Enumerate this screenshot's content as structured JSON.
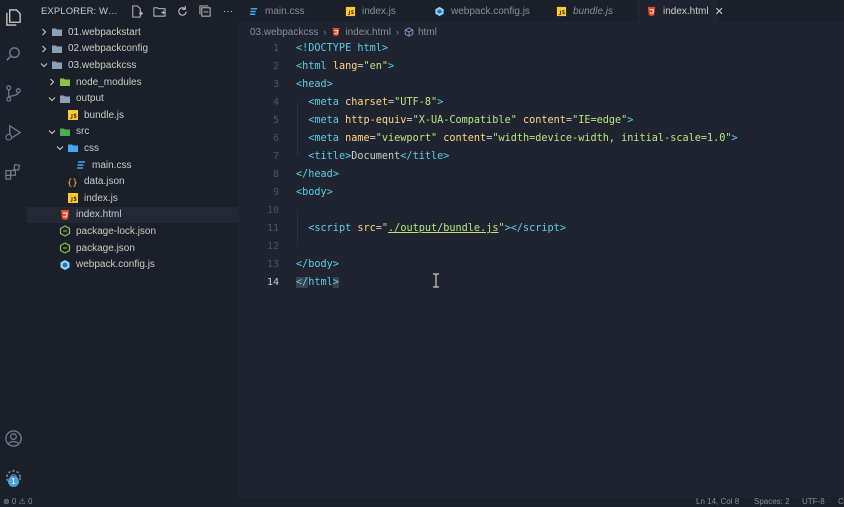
{
  "explorer": {
    "title": "EXPLORER: WPC...",
    "actions": [
      "new-file-icon",
      "new-folder-icon",
      "refresh-icon",
      "collapse-icon",
      "more-icon"
    ],
    "more_label": "···"
  },
  "tree": [
    {
      "label": "01.webpackstart",
      "type": "folder",
      "expanded": false,
      "indent": 0
    },
    {
      "label": "02.webpackconfig",
      "type": "folder",
      "expanded": false,
      "indent": 0
    },
    {
      "label": "03.webpackcss",
      "type": "folder",
      "expanded": true,
      "indent": 0
    },
    {
      "label": "node_modules",
      "type": "folder-node",
      "expanded": false,
      "indent": 1
    },
    {
      "label": "output",
      "type": "folder",
      "expanded": true,
      "indent": 1
    },
    {
      "label": "bundle.js",
      "type": "js",
      "indent": 2
    },
    {
      "label": "src",
      "type": "folder-src",
      "expanded": true,
      "indent": 1
    },
    {
      "label": "css",
      "type": "folder-css",
      "expanded": true,
      "indent": 2
    },
    {
      "label": "main.css",
      "type": "css",
      "indent": 3
    },
    {
      "label": "data.json",
      "type": "json",
      "indent": 2
    },
    {
      "label": "index.js",
      "type": "js",
      "indent": 2
    },
    {
      "label": "index.html",
      "type": "html",
      "indent": 1,
      "selected": true
    },
    {
      "label": "package-lock.json",
      "type": "npm",
      "indent": 1
    },
    {
      "label": "package.json",
      "type": "npm",
      "indent": 1
    },
    {
      "label": "webpack.config.js",
      "type": "webpack",
      "indent": 1
    }
  ],
  "tabs": [
    {
      "label": "main.css",
      "type": "css",
      "italic": false,
      "active": false
    },
    {
      "label": "index.js",
      "type": "js",
      "italic": false,
      "active": false
    },
    {
      "label": "webpack.config.js",
      "type": "webpack",
      "italic": false,
      "active": false
    },
    {
      "label": "bundle.js",
      "type": "js",
      "italic": true,
      "active": false
    },
    {
      "label": "index.html",
      "type": "html",
      "italic": false,
      "active": true,
      "close": "✕"
    }
  ],
  "breadcrumb": {
    "folder": "03.webpackcss",
    "file": "index.html",
    "symbol": "html",
    "separator": "›"
  },
  "editor": {
    "current_line": 14,
    "lines": [
      {
        "n": "1",
        "tokens": [
          {
            "t": "<!DOCTYPE html>",
            "c": "tag"
          }
        ]
      },
      {
        "n": "2",
        "tokens": [
          {
            "t": "<",
            "c": "punc"
          },
          {
            "t": "html",
            "c": "tag"
          },
          {
            "t": " lang",
            "c": "attr"
          },
          {
            "t": "=",
            "c": "txt"
          },
          {
            "t": "\"en\"",
            "c": "str"
          },
          {
            "t": ">",
            "c": "punc"
          }
        ]
      },
      {
        "n": "3",
        "tokens": [
          {
            "t": "<",
            "c": "punc"
          },
          {
            "t": "head",
            "c": "tag"
          },
          {
            "t": ">",
            "c": "punc"
          }
        ]
      },
      {
        "n": "4",
        "tokens": [
          {
            "t": "  <",
            "c": "punc"
          },
          {
            "t": "meta",
            "c": "tag"
          },
          {
            "t": " charset",
            "c": "attr"
          },
          {
            "t": "=",
            "c": "txt"
          },
          {
            "t": "\"UTF-8\"",
            "c": "str"
          },
          {
            "t": ">",
            "c": "punc"
          }
        ]
      },
      {
        "n": "5",
        "tokens": [
          {
            "t": "  <",
            "c": "punc"
          },
          {
            "t": "meta",
            "c": "tag"
          },
          {
            "t": " http-equiv",
            "c": "attr"
          },
          {
            "t": "=",
            "c": "txt"
          },
          {
            "t": "\"X-UA-Compatible\"",
            "c": "str"
          },
          {
            "t": " content",
            "c": "attr"
          },
          {
            "t": "=",
            "c": "txt"
          },
          {
            "t": "\"IE=edge\"",
            "c": "str"
          },
          {
            "t": ">",
            "c": "punc"
          }
        ]
      },
      {
        "n": "6",
        "tokens": [
          {
            "t": "  <",
            "c": "punc"
          },
          {
            "t": "meta",
            "c": "tag"
          },
          {
            "t": " name",
            "c": "attr"
          },
          {
            "t": "=",
            "c": "txt"
          },
          {
            "t": "\"viewport\"",
            "c": "str"
          },
          {
            "t": " content",
            "c": "attr"
          },
          {
            "t": "=",
            "c": "txt"
          },
          {
            "t": "\"width=device-width, initial-scale=1.0\"",
            "c": "str"
          },
          {
            "t": ">",
            "c": "punc"
          }
        ]
      },
      {
        "n": "7",
        "tokens": [
          {
            "t": "  <",
            "c": "punc"
          },
          {
            "t": "title",
            "c": "tag"
          },
          {
            "t": ">",
            "c": "punc"
          },
          {
            "t": "Document",
            "c": "txt"
          },
          {
            "t": "</",
            "c": "punc"
          },
          {
            "t": "title",
            "c": "tag"
          },
          {
            "t": ">",
            "c": "punc"
          }
        ]
      },
      {
        "n": "8",
        "tokens": [
          {
            "t": "</",
            "c": "punc"
          },
          {
            "t": "head",
            "c": "tag"
          },
          {
            "t": ">",
            "c": "punc"
          }
        ]
      },
      {
        "n": "9",
        "tokens": [
          {
            "t": "<",
            "c": "punc"
          },
          {
            "t": "body",
            "c": "tag"
          },
          {
            "t": ">",
            "c": "punc"
          }
        ]
      },
      {
        "n": "10",
        "tokens": []
      },
      {
        "n": "11",
        "tokens": [
          {
            "t": "  <",
            "c": "punc"
          },
          {
            "t": "script",
            "c": "tag"
          },
          {
            "t": " src",
            "c": "attr"
          },
          {
            "t": "=",
            "c": "txt"
          },
          {
            "t": "\"",
            "c": "str"
          },
          {
            "t": "./output/bundle.js",
            "c": "strlink"
          },
          {
            "t": "\"",
            "c": "str"
          },
          {
            "t": "></",
            "c": "punc"
          },
          {
            "t": "script",
            "c": "tag"
          },
          {
            "t": ">",
            "c": "punc"
          }
        ]
      },
      {
        "n": "12",
        "tokens": []
      },
      {
        "n": "13",
        "tokens": [
          {
            "t": "</",
            "c": "punc"
          },
          {
            "t": "body",
            "c": "tag"
          },
          {
            "t": ">",
            "c": "punc"
          }
        ]
      },
      {
        "n": "14",
        "tokens": [
          {
            "t": "</",
            "c": "punchl"
          },
          {
            "t": "html",
            "c": "tag"
          },
          {
            "t": ">",
            "c": "punchl"
          }
        ]
      }
    ]
  },
  "status": {
    "left": "⊗ 0 ⚠ 0",
    "position": "Ln 14, Col 8",
    "spaces": "Spaces: 2",
    "encoding": "UTF-8",
    "extra": "C"
  },
  "accounts_badge": "1",
  "colors": {
    "folder": "#8aa0b8",
    "node": "#8bc34a",
    "src": "#4caf50",
    "css": "#42a5f5",
    "js": "#ffca28",
    "json": "#fbc02d",
    "html": "#e44d26",
    "npm": "#8bc34a",
    "webpack": "#8ed6fb",
    "accent": "#5ccfe6"
  }
}
